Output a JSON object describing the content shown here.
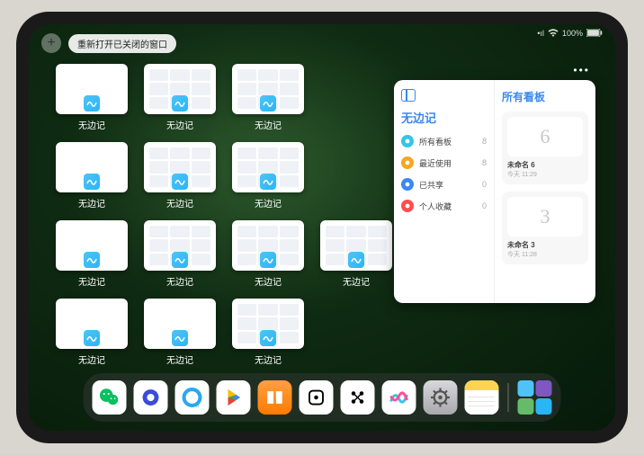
{
  "status": {
    "signal": "•ıl",
    "battery_pct": "100%"
  },
  "top": {
    "plus": "+",
    "reopen_label": "重新打开已关闭的窗口"
  },
  "app_label": "无边记",
  "windows": [
    {
      "type": "blank"
    },
    {
      "type": "calendar"
    },
    {
      "type": "calendar"
    },
    {
      "type": "blank"
    },
    {
      "type": "calendar"
    },
    {
      "type": "calendar"
    },
    {
      "type": "blank"
    },
    {
      "type": "calendar"
    },
    {
      "type": "calendar"
    },
    {
      "type": "calendar"
    },
    {
      "type": "blank"
    },
    {
      "type": "blank"
    },
    {
      "type": "calendar"
    }
  ],
  "panel": {
    "left_title": "无边记",
    "menu": [
      {
        "label": "所有看板",
        "count": "8",
        "color": "#34c5e8"
      },
      {
        "label": "最近使用",
        "count": "8",
        "color": "#f5a623"
      },
      {
        "label": "已共享",
        "count": "0",
        "color": "#3a88f0"
      },
      {
        "label": "个人收藏",
        "count": "0",
        "color": "#ff4d4f"
      }
    ],
    "right_title": "所有看板",
    "boards": [
      {
        "sketch": "6",
        "name": "未命名 6",
        "time": "今天 11:29"
      },
      {
        "sketch": "3",
        "name": "未命名 3",
        "time": "今天 11:28"
      }
    ]
  },
  "dock": [
    {
      "name": "wechat",
      "bg": "#fff",
      "glyph": "wechat"
    },
    {
      "name": "quark",
      "bg": "#fff",
      "glyph": "quark"
    },
    {
      "name": "qqbrowser",
      "bg": "#fff",
      "glyph": "qqbrowser"
    },
    {
      "name": "playstore",
      "bg": "#fff",
      "glyph": "play"
    },
    {
      "name": "books",
      "bg": "linear-gradient(#ff9f43,#ff7b00)",
      "glyph": "books"
    },
    {
      "name": "dice",
      "bg": "#fff",
      "glyph": "dice"
    },
    {
      "name": "connect",
      "bg": "#fff",
      "glyph": "connect"
    },
    {
      "name": "freeform",
      "bg": "#fff",
      "glyph": "freeform"
    },
    {
      "name": "settings",
      "bg": "linear-gradient(#d8d8dc,#a8a8ad)",
      "glyph": "gear"
    },
    {
      "name": "notes",
      "bg": "#fff",
      "glyph": "notes"
    }
  ]
}
